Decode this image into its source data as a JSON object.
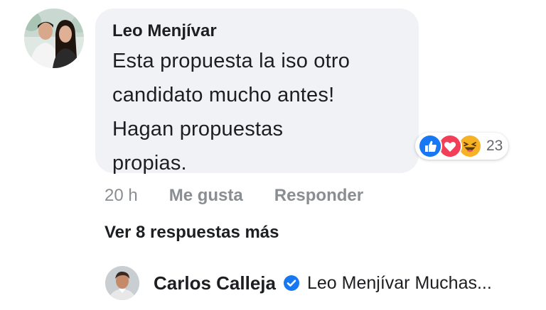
{
  "comment": {
    "author": "Leo Menjívar",
    "text": "Esta propuesta la iso otro\ncandidato mucho antes!\nHagan propuestas\npropias.",
    "avatar_icon": "profile-photo-couple",
    "reactions": {
      "icons": [
        "like-reaction-icon",
        "love-reaction-icon",
        "haha-reaction-icon"
      ],
      "count": "23",
      "colors": {
        "like": "#1877f2",
        "love": "#f33e58",
        "haha": "#f7b125"
      }
    },
    "actions": {
      "time": "20 h",
      "like_label": "Me gusta",
      "reply_label": "Responder"
    }
  },
  "more_replies_label": "Ver 8 respuestas más",
  "reply": {
    "author": "Carlos Calleja",
    "verified_icon": "verified-badge-icon",
    "preview": "Leo Menjívar Muchas..."
  },
  "colors": {
    "bubble": "#f0f2f5",
    "text": "#1c1e21",
    "secondary": "#8a8d91",
    "verified": "#1877f2"
  }
}
